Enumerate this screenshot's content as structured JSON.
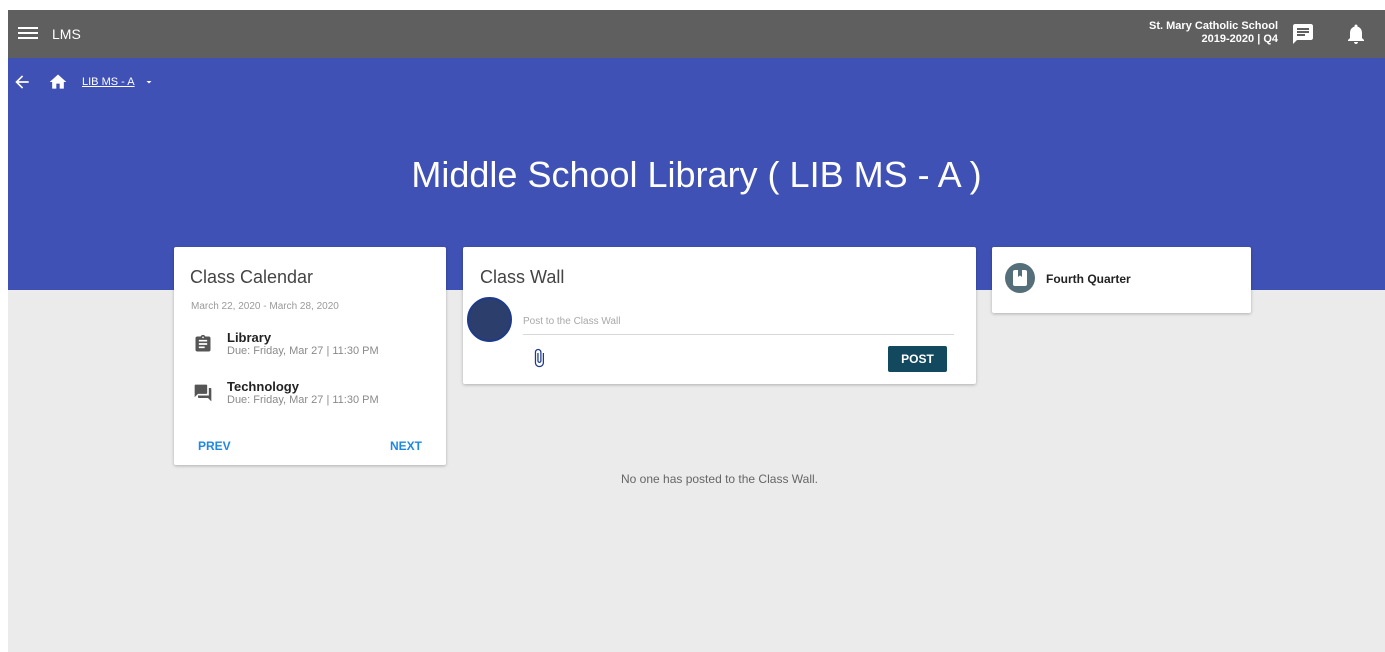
{
  "topbar": {
    "app_name": "LMS",
    "school_name": "St. Mary Catholic School",
    "term": "2019-2020 | Q4",
    "icons": [
      "menu-icon",
      "message-icon",
      "bell-icon"
    ]
  },
  "breadcrumb": {
    "course_code": "LIB MS - A",
    "icons": [
      "back-arrow-icon",
      "home-icon",
      "caret-down-icon"
    ]
  },
  "hero": {
    "title": "Middle School Library ( LIB MS - A )"
  },
  "calendar": {
    "title": "Class Calendar",
    "date_range": "March 22, 2020 - March 28, 2020",
    "items": [
      {
        "name": "Library",
        "due": "Due: Friday, Mar 27 | 11:30 PM",
        "icon": "assignment-icon"
      },
      {
        "name": "Technology",
        "due": "Due: Friday, Mar 27 | 11:30 PM",
        "icon": "forum-icon"
      }
    ],
    "prev_label": "PREV",
    "next_label": "NEXT"
  },
  "wall": {
    "title": "Class Wall",
    "placeholder": "Post to the Class Wall",
    "post_label": "POST",
    "empty_message": "No one has posted to the Class Wall."
  },
  "quarter": {
    "label": "Fourth Quarter",
    "icon": "bookmark-icon"
  },
  "colors": {
    "topbar": "#5f5f5f",
    "hero": "#3f51b5",
    "background": "#ebebeb",
    "accent_link": "#1e88e5",
    "post_button": "#12495e",
    "avatar": "#2c3e6b"
  }
}
